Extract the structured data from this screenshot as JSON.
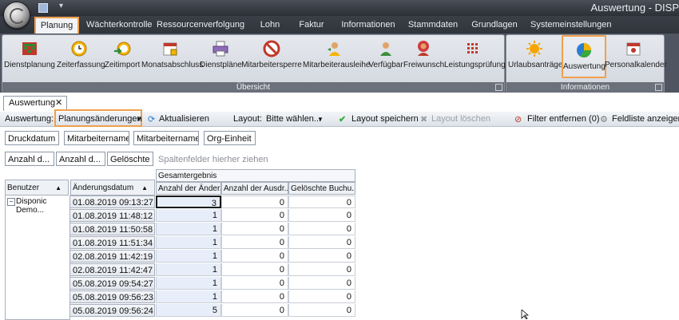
{
  "app": {
    "title": "Auswertung - DISP"
  },
  "ribbon_tabs": [
    "Planung",
    "Wächterkontrolle",
    "Ressourcenverfolgung",
    "Lohn",
    "Faktur",
    "Informationen",
    "Stammdaten",
    "Grundlagen",
    "Systemeinstellungen"
  ],
  "ribbon": {
    "group_overview": "Übersicht",
    "group_info": "Informationen",
    "buttons": [
      "Dienstplanung",
      "Zeiterfassung",
      "Zeitimport",
      "Monatsabschluss",
      "Dienstpläne",
      "Mitarbeitersperre",
      "Mitarbeiterausleihe",
      "Verfügbar",
      "Freiwunsch",
      "Leistungsprüfung"
    ],
    "info_buttons": [
      "Urlaubsanträge",
      "Auswertung",
      "Personalkalender"
    ]
  },
  "doc_tab": "Auswertung",
  "toolbar": {
    "auswertung_label": "Auswertung:",
    "auswertung_value": "Planungsänderungen",
    "refresh": "Aktualisieren",
    "layout_label": "Layout:",
    "layout_value": "Bitte wählen...",
    "save_layout": "Layout speichern",
    "delete_layout": "Layout löschen",
    "filter": "Filter entfernen (0)",
    "field_list": "Feldliste anzeigen ("
  },
  "filter_fields": [
    "Druckdatum",
    "Mitarbeitername",
    "Mitarbeitername",
    "Org-Einheit"
  ],
  "data_fields": [
    "Anzahl d...",
    "Anzahl d...",
    "Gelöschte ..."
  ],
  "column_hint": "Spaltenfelder hierher ziehen",
  "grid": {
    "total_header": "Gesamtergebnis",
    "col_headers": [
      "Anzahl der Änder...",
      "Anzahl der Ausdr...",
      "Gelöschte Buchu..."
    ],
    "row_headers": [
      "Benutzer",
      "Änderungsdatum"
    ],
    "user": "Disponic Demo...",
    "rows": [
      {
        "date": "01.08.2019 09:13:27",
        "v": [
          "3",
          "0",
          "0"
        ]
      },
      {
        "date": "01.08.2019 11:48:12",
        "v": [
          "1",
          "0",
          "0"
        ]
      },
      {
        "date": "01.08.2019 11:50:58",
        "v": [
          "1",
          "0",
          "0"
        ]
      },
      {
        "date": "01.08.2019 11:51:34",
        "v": [
          "1",
          "0",
          "0"
        ]
      },
      {
        "date": "02.08.2019 11:42:19",
        "v": [
          "1",
          "0",
          "0"
        ]
      },
      {
        "date": "02.08.2019 11:42:47",
        "v": [
          "1",
          "0",
          "0"
        ]
      },
      {
        "date": "05.08.2019 09:54:27",
        "v": [
          "1",
          "0",
          "0"
        ]
      },
      {
        "date": "05.08.2019 09:56:23",
        "v": [
          "1",
          "0",
          "0"
        ]
      },
      {
        "date": "05.08.2019 09:56:24",
        "v": [
          "5",
          "0",
          "0"
        ]
      }
    ]
  }
}
